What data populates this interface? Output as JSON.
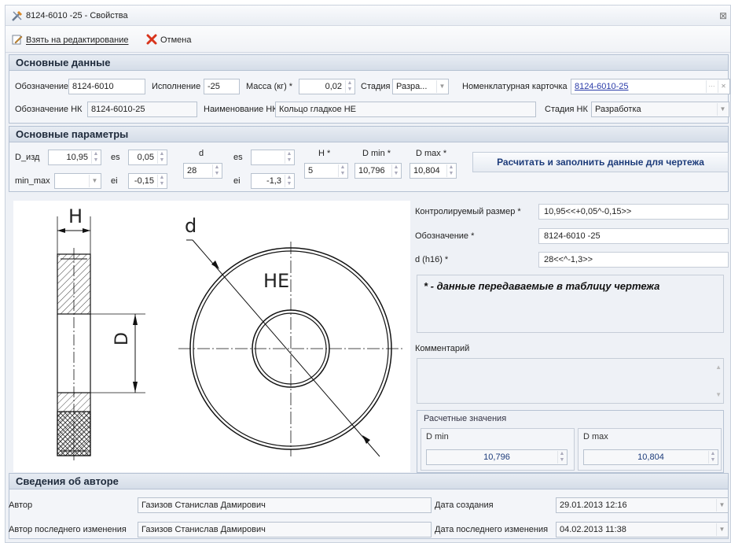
{
  "window": {
    "title": "8124-6010  -25 - Свойства",
    "close": "⊠"
  },
  "toolbar": {
    "edit_label": "Взять на редактирование",
    "cancel_label": "Отмена"
  },
  "basic": {
    "header": "Основные данные",
    "designation_label": "Обозначение",
    "designation_value": "8124-6010",
    "execution_label": "Исполнение",
    "execution_value": "-25",
    "mass_label": "Масса (кг) *",
    "mass_value": "0,02",
    "stage_label": "Стадия",
    "stage_value": "Разра...",
    "card_label": "Номенклатурная карточка",
    "card_value": "8124-6010-25",
    "nk_designation_label": "Обозначение  НК",
    "nk_designation_value": "8124-6010-25",
    "nk_name_label": "Наименование НК",
    "nk_name_value": "Кольцо гладкое НЕ",
    "nk_stage_label": "Стадия НК",
    "nk_stage_value": "Разработка"
  },
  "params": {
    "header": "Основные параметры",
    "d_izd_label": "D_изд",
    "d_izd_value": "10,95",
    "es1_label": "es",
    "es1_value": "0,05",
    "ei1_label": "ei",
    "ei1_value": "-0,15",
    "minmax_label": "min_max",
    "minmax_value": "",
    "d_label": "d",
    "d_value": "28",
    "es2_label": "es",
    "es2_value": "",
    "ei2_label": "ei",
    "ei2_value": "-1,3",
    "h_label": "H *",
    "h_value": "5",
    "dmin_label": "D min *",
    "dmin_value": "10,796",
    "dmax_label": "D max *",
    "dmax_value": "10,804",
    "calc_button": "Расчитать и заполнить данные для чертежа"
  },
  "drawing": {
    "h_label": "H",
    "d_label": "d",
    "he_label": "НЕ",
    "D_label": "D"
  },
  "right": {
    "controlled_label": "Контролируемый размер *",
    "controlled_value": "10,95<<+0,05^-0,15>>",
    "designation_label": "Обозначение *",
    "designation_value": "8124-6010  -25",
    "dh16_label": "d (h16) *",
    "dh16_value": "28<<^-1,3>>",
    "note": "* - данные передаваемые в таблицу чертежа",
    "comment_label": "Комментарий",
    "calc_group": "Расчетные значения",
    "dmin_label": "D min",
    "dmin_value": "10,796",
    "dmax_label": "D max",
    "dmax_value": "10,804"
  },
  "author": {
    "header": "Сведения об авторе",
    "author_label": "Автор",
    "author_value": "Газизов Станислав Дамирович",
    "created_label": "Дата создания",
    "created_value": "29.01.2013 12:16",
    "last_author_label": "Автор последнего изменения",
    "last_author_value": "Газизов Станислав Дамирович",
    "modified_label": "Дата последнего изменения",
    "modified_value": "04.02.2013 11:38"
  },
  "icons": {
    "title": "tools-icon",
    "edit": "pencil-icon",
    "cancel": "red-x-icon"
  }
}
